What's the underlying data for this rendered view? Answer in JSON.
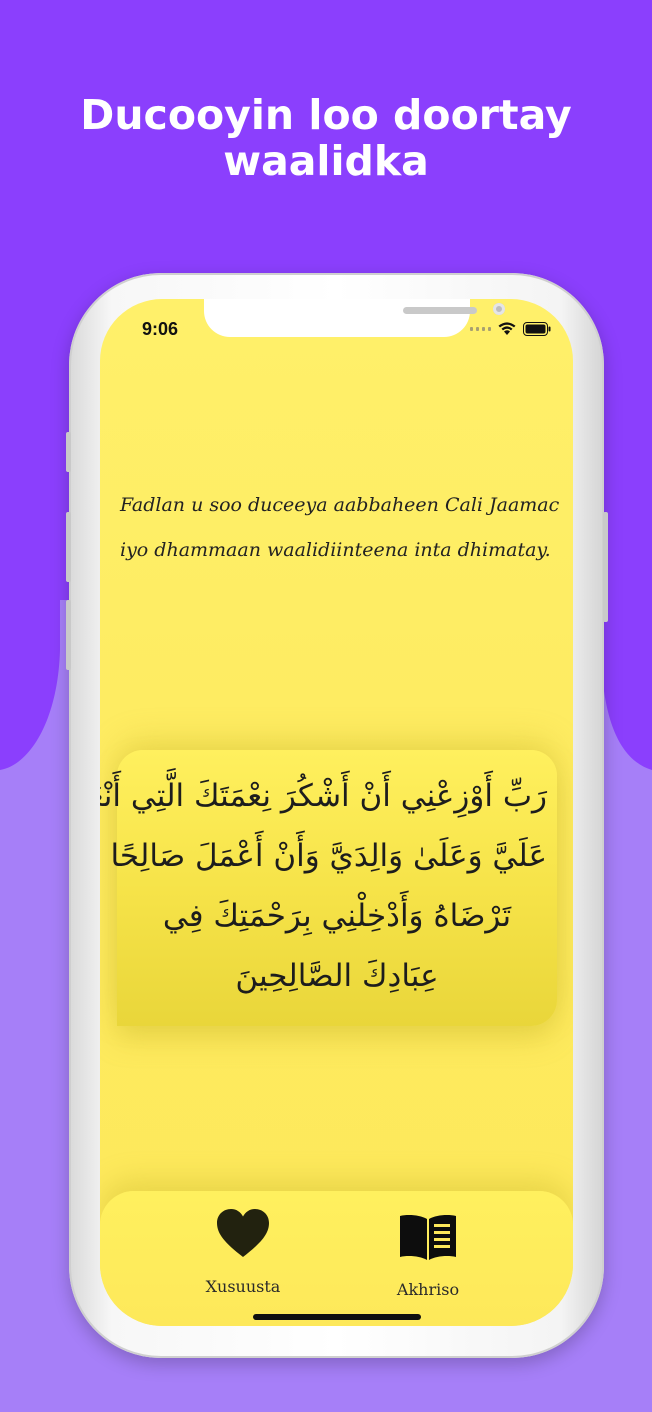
{
  "colors": {
    "background_top": "#8b3ffd",
    "background_bottom": "#a67ff8",
    "screen_yellow": "#fdeb5e",
    "text_dark": "#222222"
  },
  "headline": {
    "line1": "Ducooyin loo doortay",
    "line2": "waalidka"
  },
  "status_bar": {
    "time": "9:06",
    "icons": [
      "signal-dots-icon",
      "wifi-icon",
      "battery-icon"
    ]
  },
  "message": {
    "line1": "Fadlan u soo duceeya aabbaheen Cali Jaamac",
    "line2": "iyo dhammaan waalidiinteena inta dhimatay."
  },
  "dua": {
    "line1": "رَبِّ أَوْزِعْنِي أَنْ أَشْكُرَ نِعْمَتَكَ الَّتِي أَنْعَمْتَ",
    "line2": "عَلَيَّ وَعَلَىٰ وَالِدَيَّ وَأَنْ أَعْمَلَ صَالِحًا",
    "line3": "تَرْضَاهُ وَأَدْخِلْنِي بِرَحْمَتِكَ فِي",
    "line4": "عِبَادِكَ الصَّالِحِينَ"
  },
  "tabbar": {
    "favorites_label": "Xusuusta",
    "favorites_icon": "heart-icon",
    "read_label": "Akhriso",
    "read_icon": "book-icon"
  }
}
